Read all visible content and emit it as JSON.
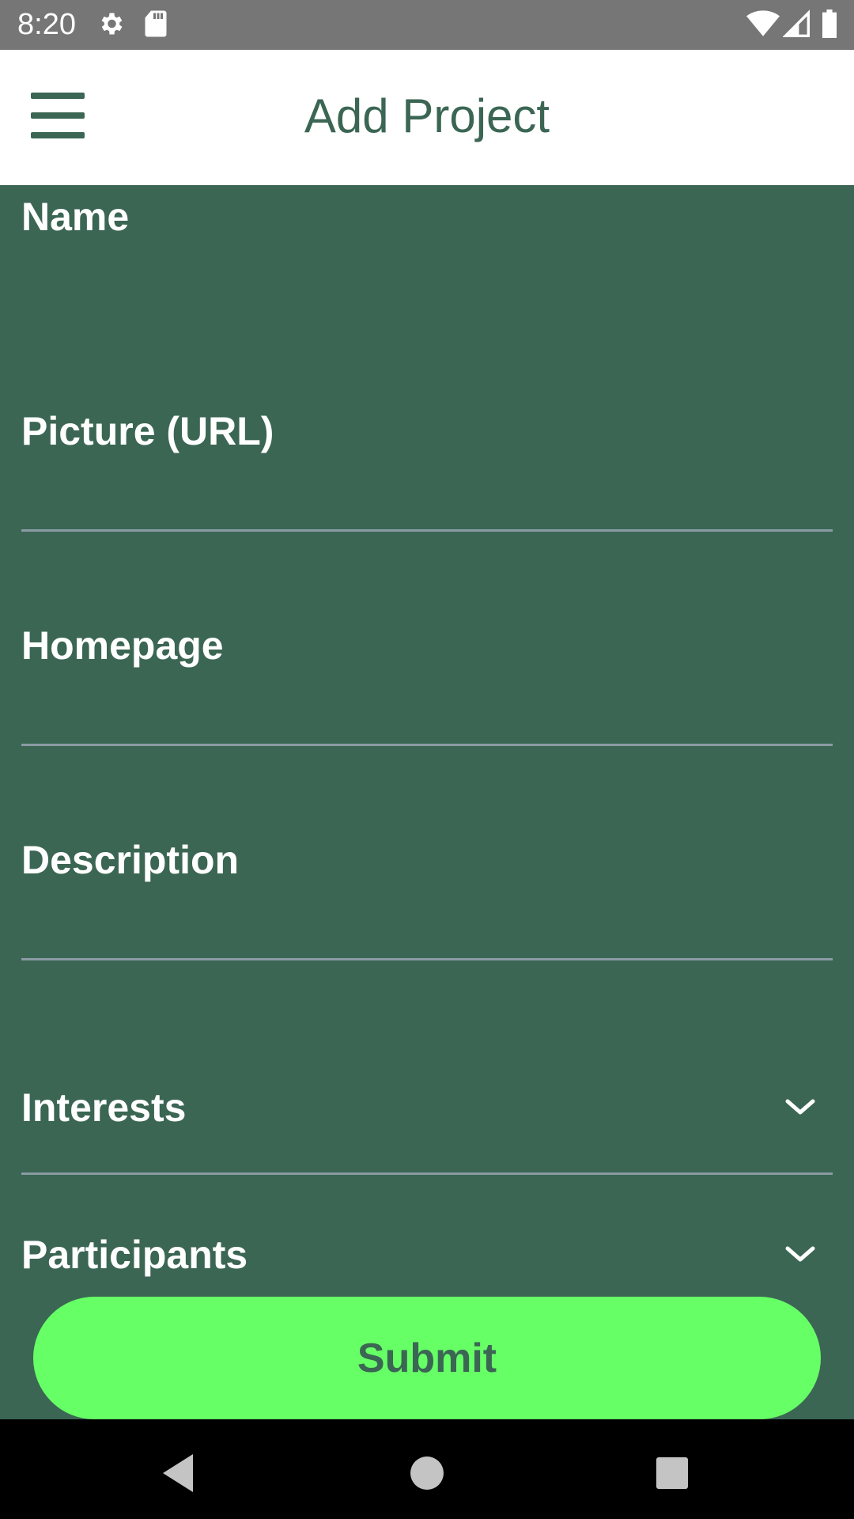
{
  "status_bar": {
    "time": "8:20",
    "icons": [
      "gear-icon",
      "sd-card-icon",
      "wifi-icon",
      "signal-icon",
      "battery-icon"
    ]
  },
  "app_bar": {
    "title": "Add Project",
    "menu_icon": "hamburger-menu-icon"
  },
  "form": {
    "name_label": "Name",
    "picture_label": "Picture (URL)",
    "homepage_label": "Homepage",
    "description_label": "Description",
    "name_value": "",
    "picture_value": "",
    "homepage_value": "",
    "description_value": ""
  },
  "dropdowns": {
    "interests_label": "Interests",
    "participants_label": "Participants"
  },
  "actions": {
    "submit_label": "Submit"
  },
  "nav_bar": {
    "icons": [
      "back-icon",
      "home-icon",
      "recents-icon"
    ]
  },
  "colors": {
    "background": "#3B6654",
    "app_bar": "#FFFFFF",
    "accent_button": "#66FF66",
    "underline": "#8A9BA4",
    "status_bar": "#767676"
  }
}
